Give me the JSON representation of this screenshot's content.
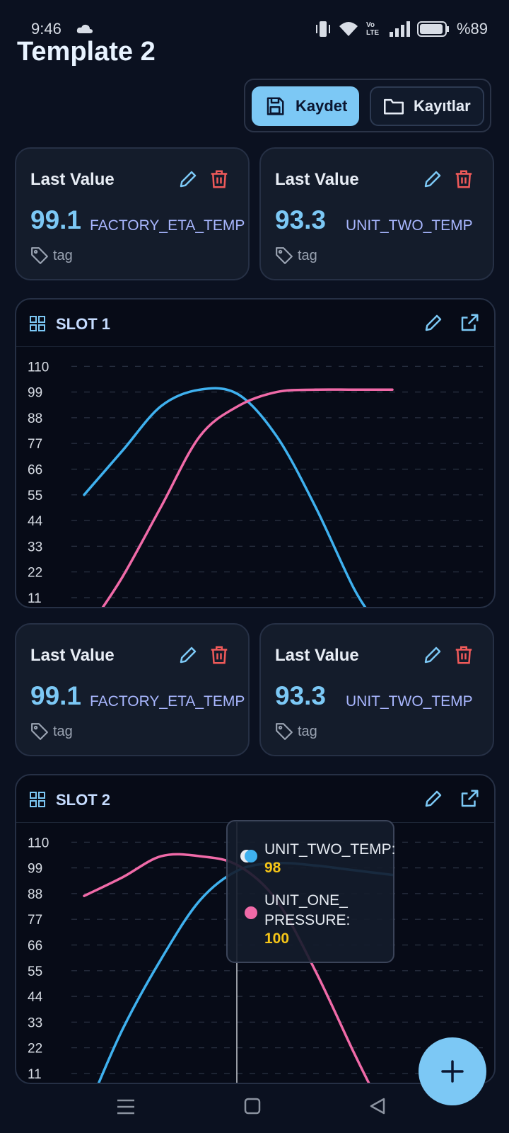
{
  "status_bar": {
    "time": "9:46",
    "battery": "%89",
    "network_label": "Vo LTE"
  },
  "page": {
    "title": "Template 2"
  },
  "toolbar": {
    "save_label": "Kaydet",
    "records_label": "Kayıtlar"
  },
  "cards_row1": [
    {
      "title": "Last Value",
      "value": "99.1",
      "series": "FACTORY_ETA_TEMP",
      "tag": "tag"
    },
    {
      "title": "Last Value",
      "value": "93.3",
      "series": "UNIT_TWO_TEMP",
      "tag": "tag"
    }
  ],
  "cards_row2": [
    {
      "title": "Last Value",
      "value": "99.1",
      "series": "FACTORY_ETA_TEMP",
      "tag": "tag"
    },
    {
      "title": "Last Value",
      "value": "93.3",
      "series": "UNIT_TWO_TEMP",
      "tag": "tag"
    }
  ],
  "slots": [
    {
      "title": "SLOT 1"
    },
    {
      "title": "SLOT 2"
    }
  ],
  "tooltip": {
    "items": [
      {
        "label": "UNIT_TWO_TEMP:",
        "value": "98"
      },
      {
        "label": "UNIT_ONE_\nPRESSURE:",
        "value": "100"
      }
    ]
  },
  "colors": {
    "accent": "#7cc8f5",
    "series_blue": "#3fb1ef",
    "series_pink": "#f06aa8",
    "delete": "#f05a5a",
    "value_yellow": "#f5c518"
  },
  "chart_data": [
    {
      "type": "line",
      "title": "SLOT 1",
      "yticks": [
        110,
        99,
        88,
        77,
        66,
        55,
        44,
        33,
        22,
        11
      ],
      "ylim": [
        0,
        110
      ],
      "grid": true,
      "series": [
        {
          "color": "#3fb1ef",
          "points": [
            [
              0,
              55
            ],
            [
              1,
              74
            ],
            [
              2,
              93
            ],
            [
              3,
              100
            ],
            [
              4,
              98
            ],
            [
              5,
              80
            ],
            [
              6,
              50
            ],
            [
              7,
              15
            ],
            [
              7.6,
              0
            ]
          ]
        },
        {
          "color": "#f06aa8",
          "points": [
            [
              0.2,
              0
            ],
            [
              1,
              20
            ],
            [
              2,
              50
            ],
            [
              3,
              80
            ],
            [
              4,
              93
            ],
            [
              5,
              99
            ],
            [
              6,
              100
            ],
            [
              7,
              100
            ],
            [
              8,
              100
            ]
          ]
        }
      ]
    },
    {
      "type": "line",
      "title": "SLOT 2",
      "yticks": [
        110,
        99,
        88,
        77,
        66,
        55,
        44,
        33,
        22,
        11
      ],
      "ylim": [
        0,
        110
      ],
      "grid": true,
      "series": [
        {
          "name": "UNIT_TWO_TEMP",
          "color": "#3fb1ef",
          "points": [
            [
              0.2,
              0
            ],
            [
              1,
              30
            ],
            [
              2,
              60
            ],
            [
              3,
              85
            ],
            [
              4,
              98
            ],
            [
              5,
              101
            ],
            [
              6,
              100
            ],
            [
              7,
              98
            ],
            [
              8,
              96
            ]
          ]
        },
        {
          "name": "UNIT_ONE_PRESSURE",
          "color": "#f06aa8",
          "points": [
            [
              0,
              87
            ],
            [
              1,
              95
            ],
            [
              2,
              104
            ],
            [
              3,
              104
            ],
            [
              4,
              100
            ],
            [
              5,
              85
            ],
            [
              6,
              55
            ],
            [
              7,
              20
            ],
            [
              7.6,
              0
            ]
          ]
        }
      ],
      "tooltip_x": 4
    }
  ]
}
